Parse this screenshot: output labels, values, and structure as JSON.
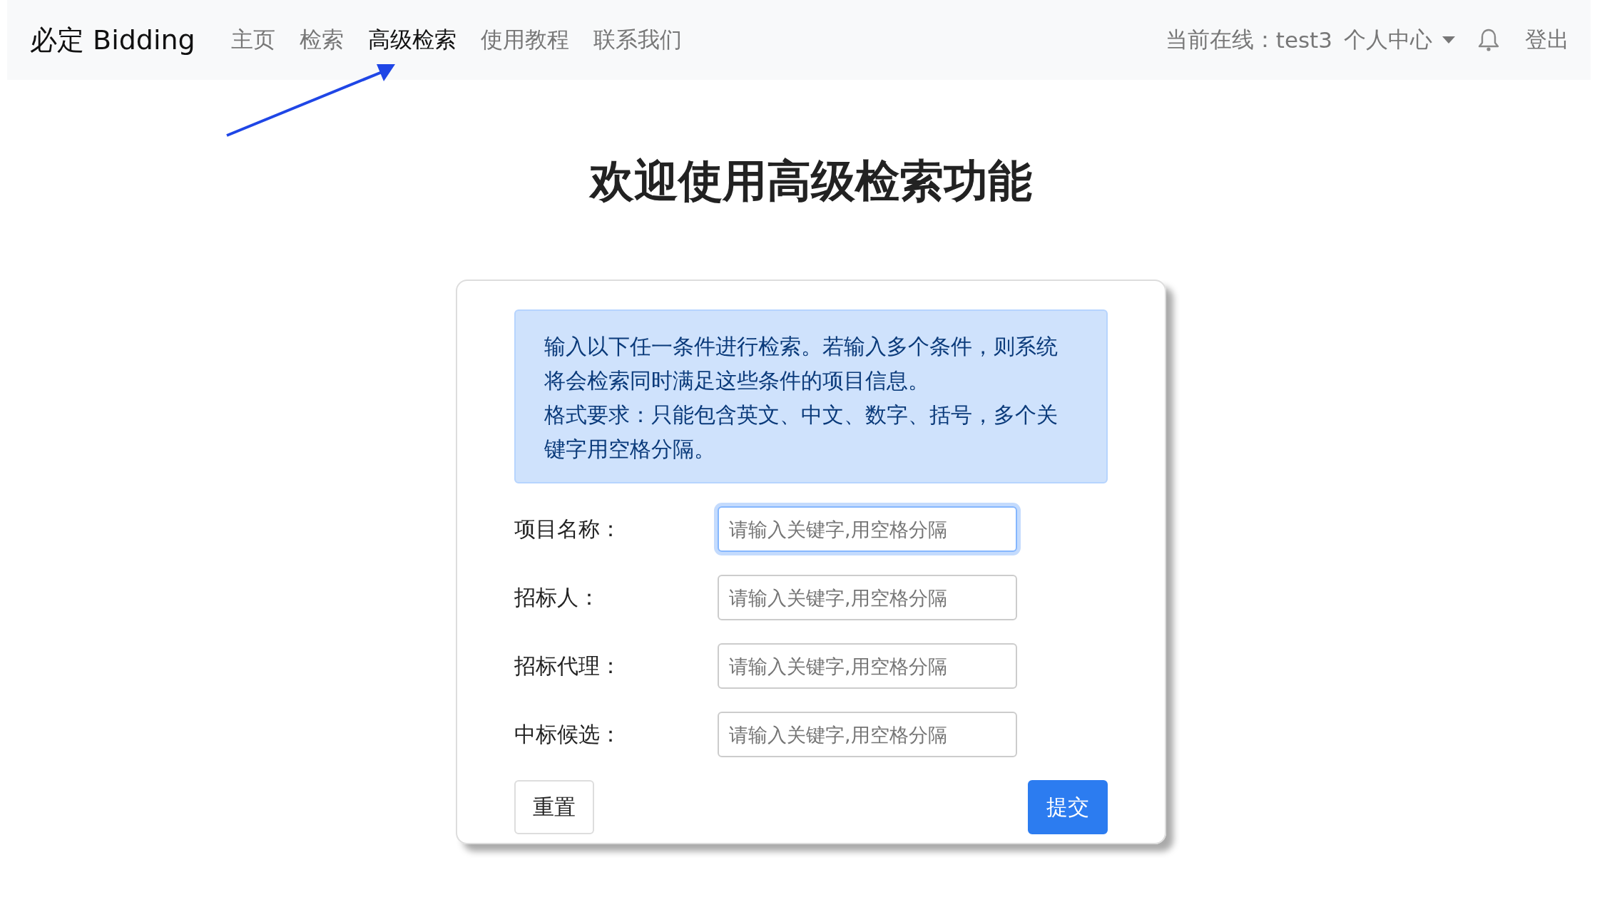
{
  "navbar": {
    "brand": "必定 Bidding",
    "links": [
      {
        "label": "主页",
        "selected": false
      },
      {
        "label": "检索",
        "selected": false
      },
      {
        "label": "高级检索",
        "selected": true
      },
      {
        "label": "使用教程",
        "selected": false
      },
      {
        "label": "联系我们",
        "selected": false
      }
    ],
    "online_label": "当前在线：",
    "username": "test3",
    "user_menu": "个人中心",
    "logout": "登出"
  },
  "heading": "欢迎使用高级检索功能",
  "notice": [
    "输入以下任一条件进行检索。若输入多个条件，则系统将会检索同时满足这些条件的项目信息。",
    "格式要求：只能包含英文、中文、数字、括号，多个关键字用空格分隔。"
  ],
  "fields": [
    {
      "label": "项目名称：",
      "placeholder": "请输入关键字,用空格分隔",
      "focused": true
    },
    {
      "label": "招标人：",
      "placeholder": "请输入关键字,用空格分隔",
      "focused": false
    },
    {
      "label": "招标代理：",
      "placeholder": "请输入关键字,用空格分隔",
      "focused": false
    },
    {
      "label": "中标候选：",
      "placeholder": "请输入关键字,用空格分隔",
      "focused": false
    }
  ],
  "buttons": [
    {
      "label": "重置",
      "kind": "secondary"
    },
    {
      "label": "提交",
      "kind": "primary"
    }
  ]
}
